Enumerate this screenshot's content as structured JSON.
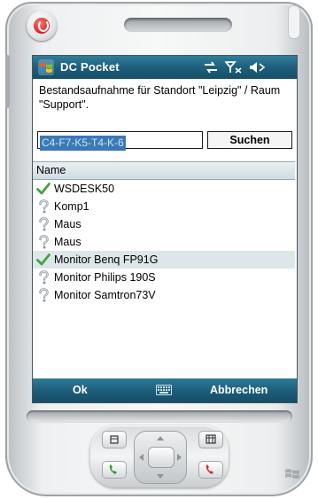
{
  "app": {
    "title": "DC Pocket"
  },
  "content": {
    "description": "Bestandsaufnahme für Standort \"Leipzig\" / Raum \"Support\"."
  },
  "search": {
    "value": "C4-F7-K5-T4-K-6",
    "button_label": "Suchen"
  },
  "list": {
    "column_header": "Name",
    "items": [
      {
        "name": "WSDESK50",
        "status": "check-icon",
        "selected": false
      },
      {
        "name": "Komp1",
        "status": "question-icon",
        "selected": false
      },
      {
        "name": "Maus",
        "status": "question-icon",
        "selected": false
      },
      {
        "name": "Maus",
        "status": "question-icon",
        "selected": false
      },
      {
        "name": "Monitor Benq FP91G",
        "status": "check-icon",
        "selected": true
      },
      {
        "name": "Monitor Philips 190S",
        "status": "question-icon",
        "selected": false
      },
      {
        "name": "Monitor Samtron73V",
        "status": "question-icon",
        "selected": false
      }
    ]
  },
  "softkeys": {
    "left": "Ok",
    "right": "Abbrechen"
  },
  "colors": {
    "titlebar": "#1e5f7b",
    "selection": "#3a79b5",
    "check": "#3fa63a"
  }
}
